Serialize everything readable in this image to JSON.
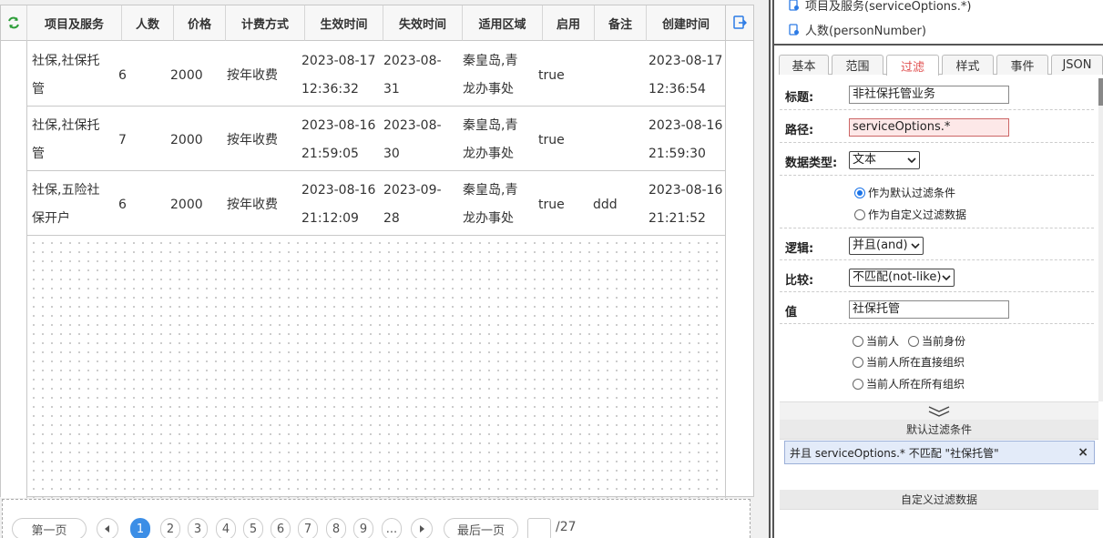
{
  "grid": {
    "columns": [
      "项目及服务",
      "人数",
      "价格",
      "计费方式",
      "生效时间",
      "失效时间",
      "适用区域",
      "启用",
      "备注",
      "创建时间"
    ],
    "rows": [
      {
        "service": [
          "社保,社保托",
          "管"
        ],
        "count": "6",
        "price": "2000",
        "billing": "按年收费",
        "start": [
          "2023-08-17",
          "12:36:32"
        ],
        "end": [
          "2023-08-",
          "31"
        ],
        "area": [
          "秦皇岛,青",
          "龙办事处"
        ],
        "enabled": "true",
        "note": "",
        "created": [
          "2023-08-17",
          "12:36:54"
        ]
      },
      {
        "service": [
          "社保,社保托",
          "管"
        ],
        "count": "7",
        "price": "2000",
        "billing": "按年收费",
        "start": [
          "2023-08-16",
          "21:59:05"
        ],
        "end": [
          "2023-08-",
          "30"
        ],
        "area": [
          "秦皇岛,青",
          "龙办事处"
        ],
        "enabled": "true",
        "note": "",
        "created": [
          "2023-08-16",
          "21:59:30"
        ]
      },
      {
        "service": [
          "社保,五险社",
          "保开户"
        ],
        "count": "6",
        "price": "2000",
        "billing": "按年收费",
        "start": [
          "2023-08-16",
          "21:12:09"
        ],
        "end": [
          "2023-09-",
          "28"
        ],
        "area": [
          "秦皇岛,青",
          "龙办事处"
        ],
        "enabled": "true",
        "note": "ddd",
        "created": [
          "2023-08-16",
          "21:21:52"
        ]
      }
    ]
  },
  "pager": {
    "first": "第一页",
    "last": "最后一页",
    "pages": [
      "1",
      "2",
      "3",
      "4",
      "5",
      "6",
      "7",
      "8",
      "9",
      "..."
    ],
    "active": "1",
    "total": "/27"
  },
  "tree": {
    "items": [
      "项目及服务(serviceOptions.*)",
      "人数(personNumber)"
    ]
  },
  "tabs": [
    "基本",
    "范围",
    "过滤",
    "样式",
    "事件",
    "JSON"
  ],
  "active_tab": "过滤",
  "form": {
    "title_label": "标题:",
    "title_value": "非社保托管业务",
    "path_label": "路径:",
    "path_value": "serviceOptions.*",
    "datatype_label": "数据类型:",
    "datatype_value": "文本",
    "radio_default": "作为默认过滤条件",
    "radio_custom": "作为自定义过滤数据",
    "logic_label": "逻辑:",
    "logic_value": "并且(and)",
    "compare_label": "比较:",
    "compare_value": "不匹配(not-like)",
    "value_label": "值",
    "value_value": "社保托管",
    "opt_current_person": "当前人",
    "opt_current_identity": "当前身份",
    "opt_direct_org": "当前人所在直接组织",
    "opt_all_org": "当前人所在所有组织"
  },
  "sections": {
    "default_filters": "默认过滤条件",
    "custom_filters": "自定义过滤数据"
  },
  "chip": {
    "text": "并且 serviceOptions.* 不匹配 \"社保托管\"",
    "close": "×"
  },
  "colors": {
    "accent": "#3c8ee6",
    "active_tab": "#e05050",
    "path_highlight": "#fde8e8"
  }
}
